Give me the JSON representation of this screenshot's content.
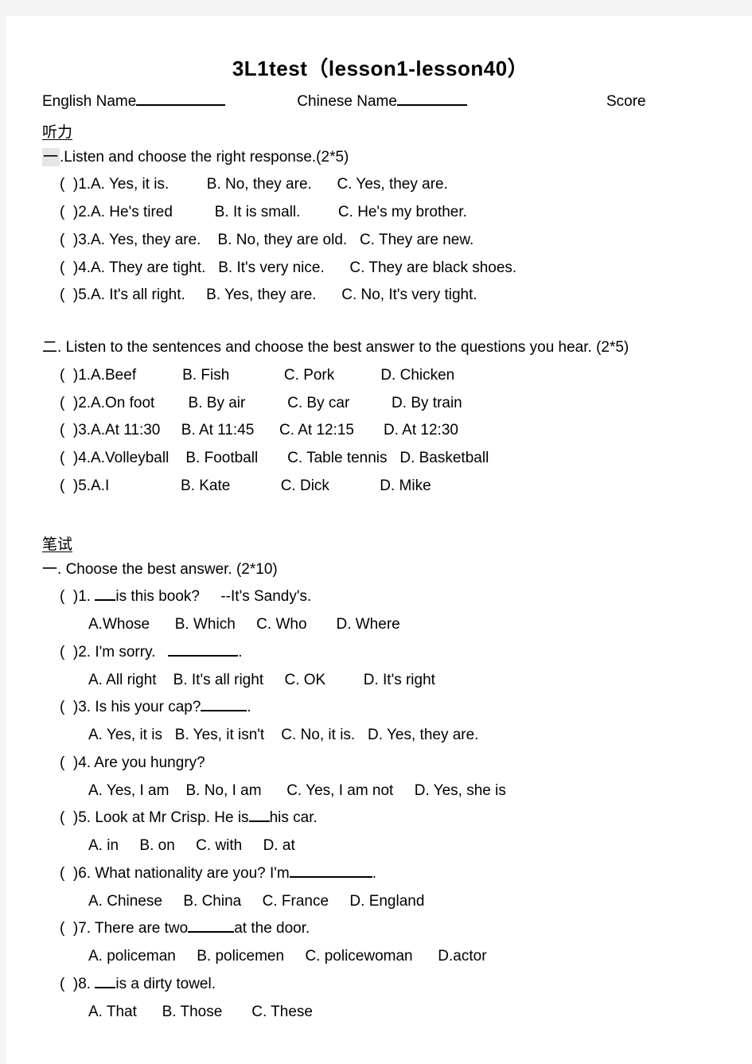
{
  "document": {
    "title": "3L1test（lesson1-lesson40）",
    "header": {
      "english_name_label": "English Name",
      "chinese_name_label": "Chinese Name",
      "score_label": "Score"
    },
    "listening_section": {
      "heading": "听力",
      "parts": [
        {
          "marker": "一",
          "instruction": ".Listen and choose the right response.(2*5)",
          "questions": [
            "(  )1.A. Yes, it is.         B. No, they are.      C. Yes, they are.",
            "(  )2.A. He's tired          B. It is small.         C. He's my brother.",
            "(  )3.A. Yes, they are.    B. No, they are old.   C. They are new.",
            "(  )4.A. They are tight.   B. It's very nice.      C. They are black shoes.",
            "(  )5.A. It's all right.     B. Yes, they are.      C. No, It's very tight."
          ]
        },
        {
          "marker": "二",
          "instruction": ". Listen to the sentences and choose the best answer to the questions you hear. (2*5)",
          "questions": [
            "(  )1.A.Beef           B. Fish             C. Pork           D. Chicken",
            "(  )2.A.On foot        B. By air          C. By car          D. By train",
            "(  )3.A.At 11:30     B. At 11:45      C. At 12:15       D. At 12:30",
            "(  )4.A.Volleyball    B. Football       C. Table tennis   D. Basketball",
            "(  )5.A.I                 B. Kate            C. Dick            D. Mike"
          ]
        }
      ]
    },
    "written_section": {
      "heading": "笔试",
      "marker": "一",
      "instruction": ". Choose the best answer. (2*10)",
      "questions": [
        {
          "stem_before": "(  )1. ",
          "stem_after": "is this book?     --It's Sandy's.",
          "blank_class": "u-2",
          "options": "A.Whose      B. Which     C. Who       D. Where"
        },
        {
          "stem_before": "(  )2. I'm sorry.   ",
          "stem_after": ".",
          "blank_class": "u-6",
          "options": "A. All right    B. It's all right     C. OK         D. It's right"
        },
        {
          "stem_before": "(  )3. Is his your cap?",
          "stem_after": ".",
          "blank_class": "u-4",
          "options": "A. Yes, it is   B. Yes, it isn't    C. No, it is.   D. Yes, they are."
        },
        {
          "stem_before": "(  )4. Are you hungry?",
          "stem_after": "",
          "blank_class": "",
          "options": "A. Yes, I am    B. No, I am      C. Yes, I am not     D. Yes, she is"
        },
        {
          "stem_before": "(  )5. Look at Mr Crisp. He is",
          "stem_after": "his car.",
          "blank_class": "u-2",
          "options": "A. in     B. on     C. with     D. at"
        },
        {
          "stem_before": "(  )6. What nationality are you? I'm",
          "stem_after": ".",
          "blank_class": "u-7",
          "options": "A. Chinese     B. China     C. France     D. England"
        },
        {
          "stem_before": "(  )7. There are two",
          "stem_after": "at the door.",
          "blank_class": "u-4",
          "options": "A. policeman     B. policemen     C. policewoman      D.actor"
        },
        {
          "stem_before": "(  )8. ",
          "stem_after": "is a dirty towel.",
          "blank_class": "u-2",
          "options": "A. That      B. Those       C. These"
        }
      ]
    }
  }
}
